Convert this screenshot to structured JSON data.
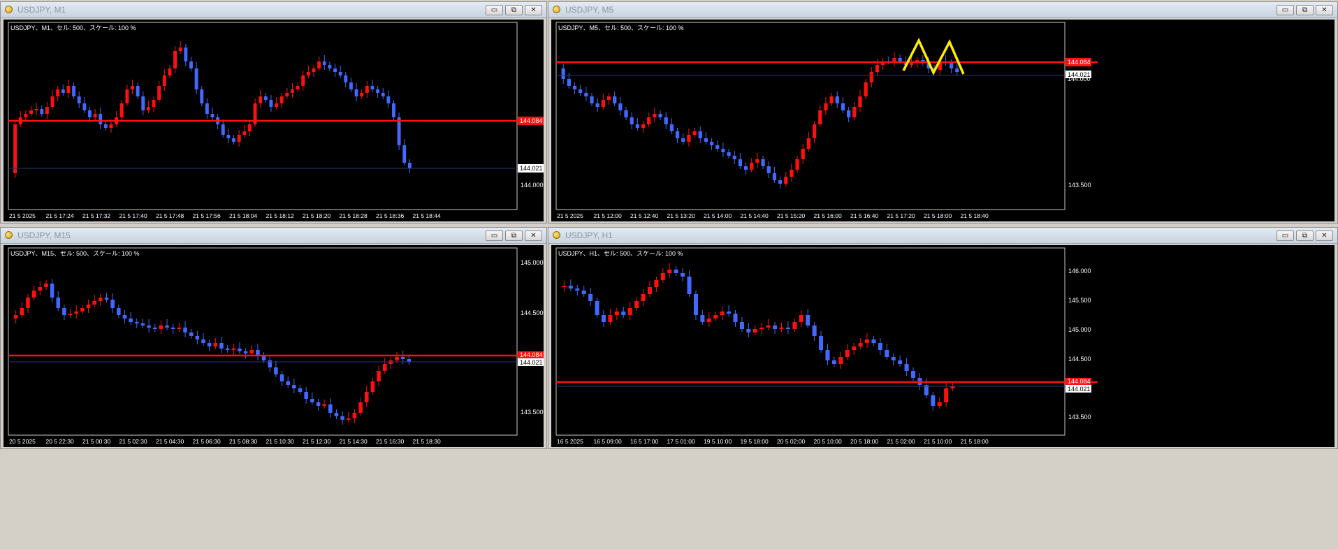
{
  "colors": {
    "bull": "#ff1010",
    "bear": "#4169ff",
    "line": "#ff1010",
    "bid": "#23397a",
    "zigzag": "#ffee00",
    "bg": "#000000",
    "text": "#ffffff"
  },
  "window_buttons": {
    "minimize": "▭",
    "restore": "⧉",
    "close": "✕"
  },
  "windows": [
    {
      "title": "USDJPY, M1",
      "chart_label": "USDJPY、M1、セル: 500、スケール: 100 %",
      "price_labels": {
        "red": "144.084",
        "white": "144.021"
      },
      "y_ticks": [
        "144.000"
      ],
      "x_ticks": [
        "21 5 2025",
        "21 5 17:24",
        "21 5 17:32",
        "21 5 17:40",
        "21 5 17:48",
        "21 5 17:56",
        "21 5 18:04",
        "21 5 18:12",
        "21 5 18:20",
        "21 5 18:28",
        "21 5 18:36",
        "21 5 18:44"
      ]
    },
    {
      "title": "USDJPY, M5",
      "chart_label": "USDJPY、M5、セル: 500、スケール: 100 %",
      "price_labels": {
        "red": "144.084",
        "white": "144.021",
        "overlap": "144.000"
      },
      "y_ticks": [
        "143.500"
      ],
      "x_ticks": [
        "21 5 2025",
        "21 5 12:00",
        "21 5 12:40",
        "21 5 13:20",
        "21 5 14:00",
        "21 5 14:40",
        "21 5 15:20",
        "21 5 16:00",
        "21 5 16:40",
        "21 5 17:20",
        "21 5 18:00",
        "21 5 18:40"
      ]
    },
    {
      "title": "USDJPY, M15",
      "chart_label": "USDJPY、M15、セル: 500、スケール: 100 %",
      "price_labels": {
        "red": "144.084",
        "white": "144.021"
      },
      "y_ticks": [
        "145.000",
        "144.500",
        "143.500"
      ],
      "x_ticks": [
        "20 5 2025",
        "20 5 22:30",
        "21 5 00:30",
        "21 5 02:30",
        "21 5 04:30",
        "21 5 06:30",
        "21 5 08:30",
        "21 5 10:30",
        "21 5 12:30",
        "21 5 14:30",
        "21 5 16:30",
        "21 5 18:30"
      ]
    },
    {
      "title": "USDJPY, H1",
      "chart_label": "USDJPY、H1、セル: 500、スケール: 100 %",
      "price_labels": {
        "red": "144.084",
        "white": "144.021"
      },
      "y_ticks": [
        "146.000",
        "145.500",
        "145.000",
        "144.500",
        "143.500"
      ],
      "x_ticks": [
        "16 5 2025",
        "16 5 09:00",
        "16 5 17:00",
        "17 5 01:00",
        "19 5 10:00",
        "19 5 18:00",
        "20 5 02:00",
        "20 5 10:00",
        "20 5 18:00",
        "21 5 02:00",
        "21 5 10:00",
        "21 5 18:00"
      ]
    }
  ]
}
